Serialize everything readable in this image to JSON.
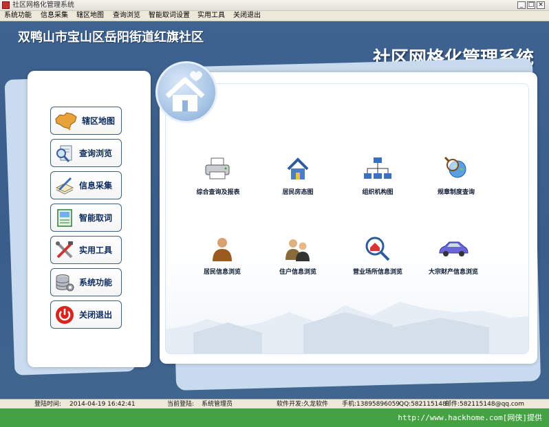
{
  "window": {
    "title": "社区网格化管理系统"
  },
  "menu": [
    "系统功能",
    "信息采集",
    "辖区地图",
    "查询浏览",
    "智能取词设置",
    "实用工具",
    "关闭退出"
  ],
  "header": {
    "district": "双鸭山市宝山区岳阳街道红旗社区",
    "system_title": "社区网格化管理系统"
  },
  "nav": [
    {
      "label": "辖区地图",
      "icon": "china-map-icon"
    },
    {
      "label": "查询浏览",
      "icon": "magnifier-document-icon"
    },
    {
      "label": "信息采集",
      "icon": "pen-paper-icon"
    },
    {
      "label": "智能取词",
      "icon": "scan-document-icon"
    },
    {
      "label": "实用工具",
      "icon": "tools-icon"
    },
    {
      "label": "系统功能",
      "icon": "database-gear-icon"
    },
    {
      "label": "关闭退出",
      "icon": "power-icon"
    }
  ],
  "functions": [
    {
      "label": "综合查询及报表",
      "icon": "printer-icon"
    },
    {
      "label": "居民房态图",
      "icon": "house-icon"
    },
    {
      "label": "组织机构图",
      "icon": "org-chart-icon"
    },
    {
      "label": "规章制度查询",
      "icon": "magnifier-globe-icon"
    },
    {
      "label": "居民信息浏览",
      "icon": "person-icon"
    },
    {
      "label": "住户信息浏览",
      "icon": "family-icon"
    },
    {
      "label": "营业场所信息浏览",
      "icon": "search-house-icon"
    },
    {
      "label": "大宗财产信息浏览",
      "icon": "car-icon"
    }
  ],
  "status": {
    "login_time_label": "登陆时间:",
    "login_time": "2014-04-19 16:42:41",
    "current_user_label": "当前登陆:",
    "current_user": "系统管理员",
    "developer": "软件开发:久龙软件",
    "phone": "手机:13895896059",
    "qq": "QQ:582115148",
    "email": "邮件:582115148@qq.com"
  },
  "watermark": "http://www.hackhome.com[网侠]提供"
}
